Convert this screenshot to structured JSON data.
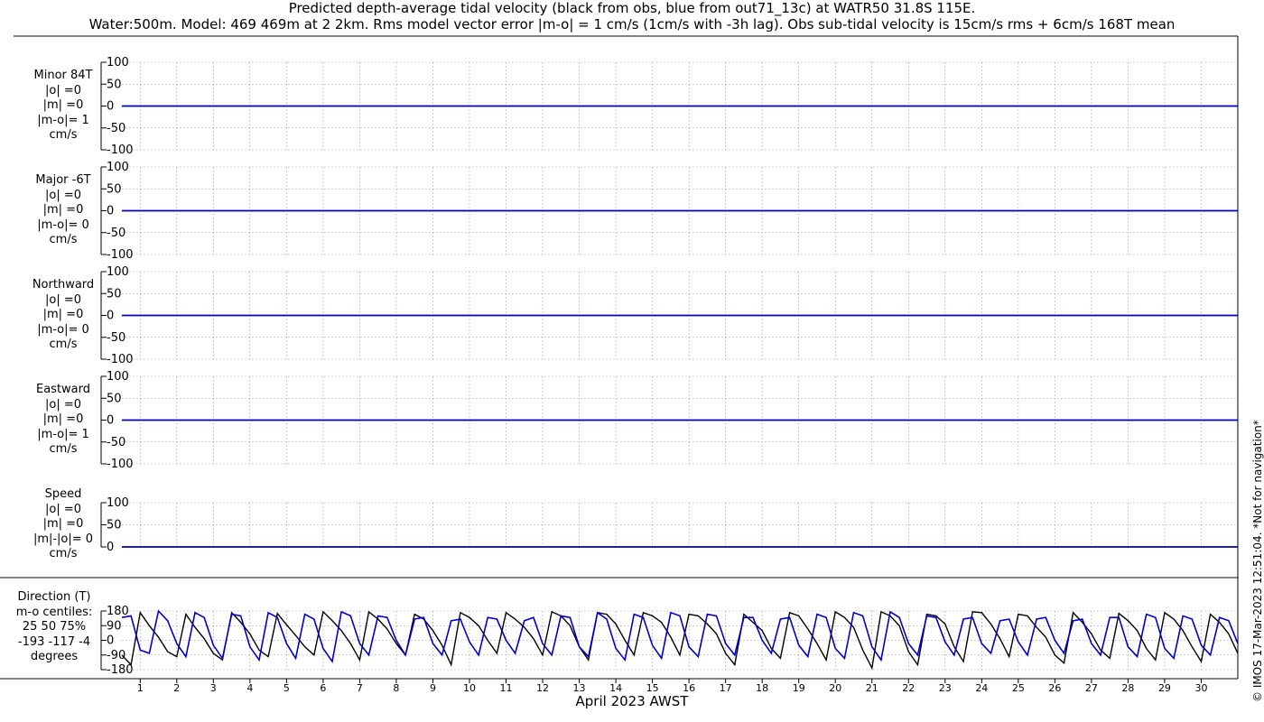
{
  "title_line1": "Predicted depth-average tidal velocity (black from obs, blue from out71_13c) at WATR50 31.8S 115E.",
  "title_line2": "Water:500m. Model: 469 469m at 2 2km. Rms model vector error |m-o| = 1 cm/s (1cm/s with -3h lag). Obs sub-tidal velocity is 15cm/s rms + 6cm/s 168T mean",
  "xlabel": "April 2023 AWST",
  "credit": "© IMOS 17-Mar-2023 12:51:04. *Not for navigation*",
  "colors": {
    "obs": "#000000",
    "model": "#0000cc",
    "grid": "#888888"
  },
  "panels": [
    {
      "name": "minor",
      "labels": [
        "Minor 84T",
        "|o| =0",
        "|m| =0",
        "|m-o|= 1",
        "cm/s"
      ]
    },
    {
      "name": "major",
      "labels": [
        "Major -6T",
        "|o| =0",
        "|m| =0",
        "|m-o|= 0",
        "cm/s"
      ]
    },
    {
      "name": "northward",
      "labels": [
        "Northward",
        "|o| =0",
        "|m| =0",
        "|m-o|= 0",
        "cm/s"
      ]
    },
    {
      "name": "eastward",
      "labels": [
        "Eastward",
        "|o| =0",
        "|m| =0",
        "|m-o|= 1",
        "cm/s"
      ]
    },
    {
      "name": "speed",
      "labels": [
        "Speed",
        "|o| =0",
        "|m| =0",
        "|m|-|o|= 0",
        "cm/s"
      ]
    },
    {
      "name": "direction",
      "labels": [
        "Direction (T)",
        "m-o centiles:",
        "25  50  75%",
        "-193 -117   -4",
        "degrees"
      ]
    }
  ],
  "chart_data": [
    {
      "type": "line",
      "panel": "Minor 84T",
      "ylim": [
        -100,
        100
      ],
      "yticks": [
        -100,
        -50,
        0,
        50,
        100
      ],
      "xlim": [
        0.5,
        31.0
      ],
      "grid": true,
      "series": [
        {
          "name": "obs",
          "values": "constant 0"
        },
        {
          "name": "model",
          "values": "constant 0"
        }
      ],
      "x": [
        0.5,
        31.0
      ],
      "y_obs": [
        0,
        0
      ],
      "y_model": [
        0,
        0
      ]
    },
    {
      "type": "line",
      "panel": "Major -6T",
      "ylim": [
        -100,
        100
      ],
      "yticks": [
        -100,
        -50,
        0,
        50,
        100
      ],
      "xlim": [
        0.5,
        31.0
      ],
      "grid": true,
      "x": [
        0.5,
        31.0
      ],
      "y_obs": [
        0,
        0
      ],
      "y_model": [
        0,
        0
      ]
    },
    {
      "type": "line",
      "panel": "Northward",
      "ylim": [
        -100,
        100
      ],
      "yticks": [
        -100,
        -50,
        0,
        50,
        100
      ],
      "xlim": [
        0.5,
        31.0
      ],
      "grid": true,
      "x": [
        0.5,
        31.0
      ],
      "y_obs": [
        0,
        0
      ],
      "y_model": [
        0,
        0
      ]
    },
    {
      "type": "line",
      "panel": "Eastward",
      "ylim": [
        -100,
        100
      ],
      "yticks": [
        -100,
        -50,
        0,
        50,
        100
      ],
      "xlim": [
        0.5,
        31.0
      ],
      "grid": true,
      "x": [
        0.5,
        31.0
      ],
      "y_obs": [
        0,
        0
      ],
      "y_model": [
        0,
        0
      ]
    },
    {
      "type": "line",
      "panel": "Speed",
      "ylim": [
        0,
        100
      ],
      "yticks": [
        0,
        50,
        100
      ],
      "xlim": [
        0.5,
        31.0
      ],
      "grid": true,
      "x": [
        0.5,
        31.0
      ],
      "y_obs": [
        0,
        0
      ],
      "y_model": [
        0,
        0
      ]
    },
    {
      "type": "line",
      "panel": "Direction (T)",
      "ylim": [
        -180,
        180
      ],
      "yticks": [
        -180,
        -90,
        0,
        90,
        180
      ],
      "xlim": [
        0.5,
        31.0
      ],
      "grid": true,
      "xticks": [
        1,
        2,
        3,
        4,
        5,
        6,
        7,
        8,
        9,
        10,
        11,
        12,
        13,
        14,
        15,
        16,
        17,
        18,
        19,
        20,
        21,
        22,
        23,
        24,
        25,
        26,
        27,
        28,
        29,
        30
      ],
      "xlabel": "April 2023 AWST",
      "x": [
        0.5,
        0.75,
        1.0,
        1.25,
        1.5,
        1.75,
        2.0,
        2.25,
        2.5,
        2.75,
        3.0,
        3.25,
        3.5,
        3.75,
        4.0,
        4.25,
        4.5,
        4.75,
        5.0,
        5.25,
        5.5,
        5.75,
        6.0,
        6.25,
        6.5,
        6.75,
        7.0,
        7.25,
        7.5,
        7.75,
        8.0,
        8.25,
        8.5,
        8.75,
        9.0,
        9.25,
        9.5,
        9.75,
        10.0,
        10.25,
        10.5,
        10.75,
        11.0,
        11.25,
        11.5,
        11.75,
        12.0,
        12.25,
        12.5,
        12.75,
        13.0,
        13.25,
        13.5,
        13.75,
        14.0,
        14.25,
        14.5,
        14.75,
        15.0,
        15.25,
        15.5,
        15.75,
        16.0,
        16.25,
        16.5,
        16.75,
        17.0,
        17.25,
        17.5,
        17.75,
        18.0,
        18.25,
        18.5,
        18.75,
        19.0,
        19.25,
        19.5,
        19.75,
        20.0,
        20.25,
        20.5,
        20.75,
        21.0,
        21.25,
        21.5,
        21.75,
        22.0,
        22.25,
        22.5,
        22.75,
        23.0,
        23.25,
        23.5,
        23.75,
        24.0,
        24.25,
        24.5,
        24.75,
        25.0,
        25.25,
        25.5,
        25.75,
        26.0,
        26.25,
        26.5,
        26.75,
        27.0,
        27.25,
        27.5,
        27.75,
        28.0,
        28.25,
        28.5,
        28.75,
        29.0,
        29.25,
        29.5,
        29.75,
        30.0,
        30.25,
        30.5,
        30.75,
        31.0
      ],
      "y_obs": [
        -90,
        -150,
        170,
        90,
        20,
        -70,
        -100,
        160,
        80,
        10,
        -80,
        -120,
        170,
        110,
        40,
        -60,
        -100,
        165,
        95,
        30,
        -40,
        -90,
        175,
        120,
        60,
        -20,
        -120,
        175,
        130,
        70,
        -20,
        -90,
        160,
        130,
        60,
        -30,
        -150,
        170,
        140,
        90,
        0,
        -80,
        170,
        130,
        80,
        10,
        -90,
        175,
        150,
        90,
        -40,
        -120,
        170,
        160,
        100,
        0,
        -90,
        170,
        150,
        110,
        20,
        -90,
        160,
        150,
        100,
        40,
        -80,
        -150,
        160,
        110,
        60,
        -50,
        -110,
        170,
        150,
        70,
        -20,
        -120,
        175,
        140,
        80,
        -60,
        -170,
        175,
        150,
        90,
        -70,
        -150,
        160,
        150,
        100,
        -40,
        -130,
        175,
        170,
        100,
        10,
        -100,
        160,
        150,
        80,
        20,
        -90,
        -140,
        170,
        110,
        40,
        -60,
        -110,
        165,
        120,
        60,
        -50,
        -120,
        170,
        130,
        60,
        -40,
        -130,
        160,
        110,
        40,
        -80,
        -150,
        150,
        100,
        20,
        -90
      ],
      "y_model": [
        140,
        150,
        -60,
        -80,
        180,
        120,
        -20,
        -100,
        170,
        140,
        -30,
        -110,
        160,
        150,
        -40,
        -120,
        170,
        140,
        -20,
        -110,
        160,
        130,
        -50,
        -130,
        175,
        150,
        -20,
        -90,
        150,
        140,
        0,
        -90,
        130,
        140,
        -20,
        -90,
        120,
        130,
        -10,
        -90,
        140,
        130,
        0,
        -80,
        120,
        140,
        -20,
        -90,
        150,
        140,
        -40,
        -100,
        170,
        130,
        -50,
        -120,
        160,
        140,
        -30,
        -110,
        170,
        150,
        -40,
        -100,
        160,
        150,
        -20,
        -90,
        140,
        140,
        0,
        -80,
        130,
        140,
        -30,
        -100,
        160,
        140,
        -50,
        -110,
        170,
        150,
        -40,
        -120,
        175,
        140,
        -20,
        -90,
        150,
        140,
        -10,
        -90,
        130,
        140,
        -20,
        -80,
        120,
        130,
        -10,
        -90,
        130,
        140,
        0,
        -80,
        120,
        130,
        -20,
        -90,
        140,
        140,
        -40,
        -100,
        160,
        140,
        -50,
        -110,
        150,
        130,
        -30,
        -90,
        140,
        120,
        -20,
        -80,
        130,
        120,
        -10
      ]
    }
  ]
}
